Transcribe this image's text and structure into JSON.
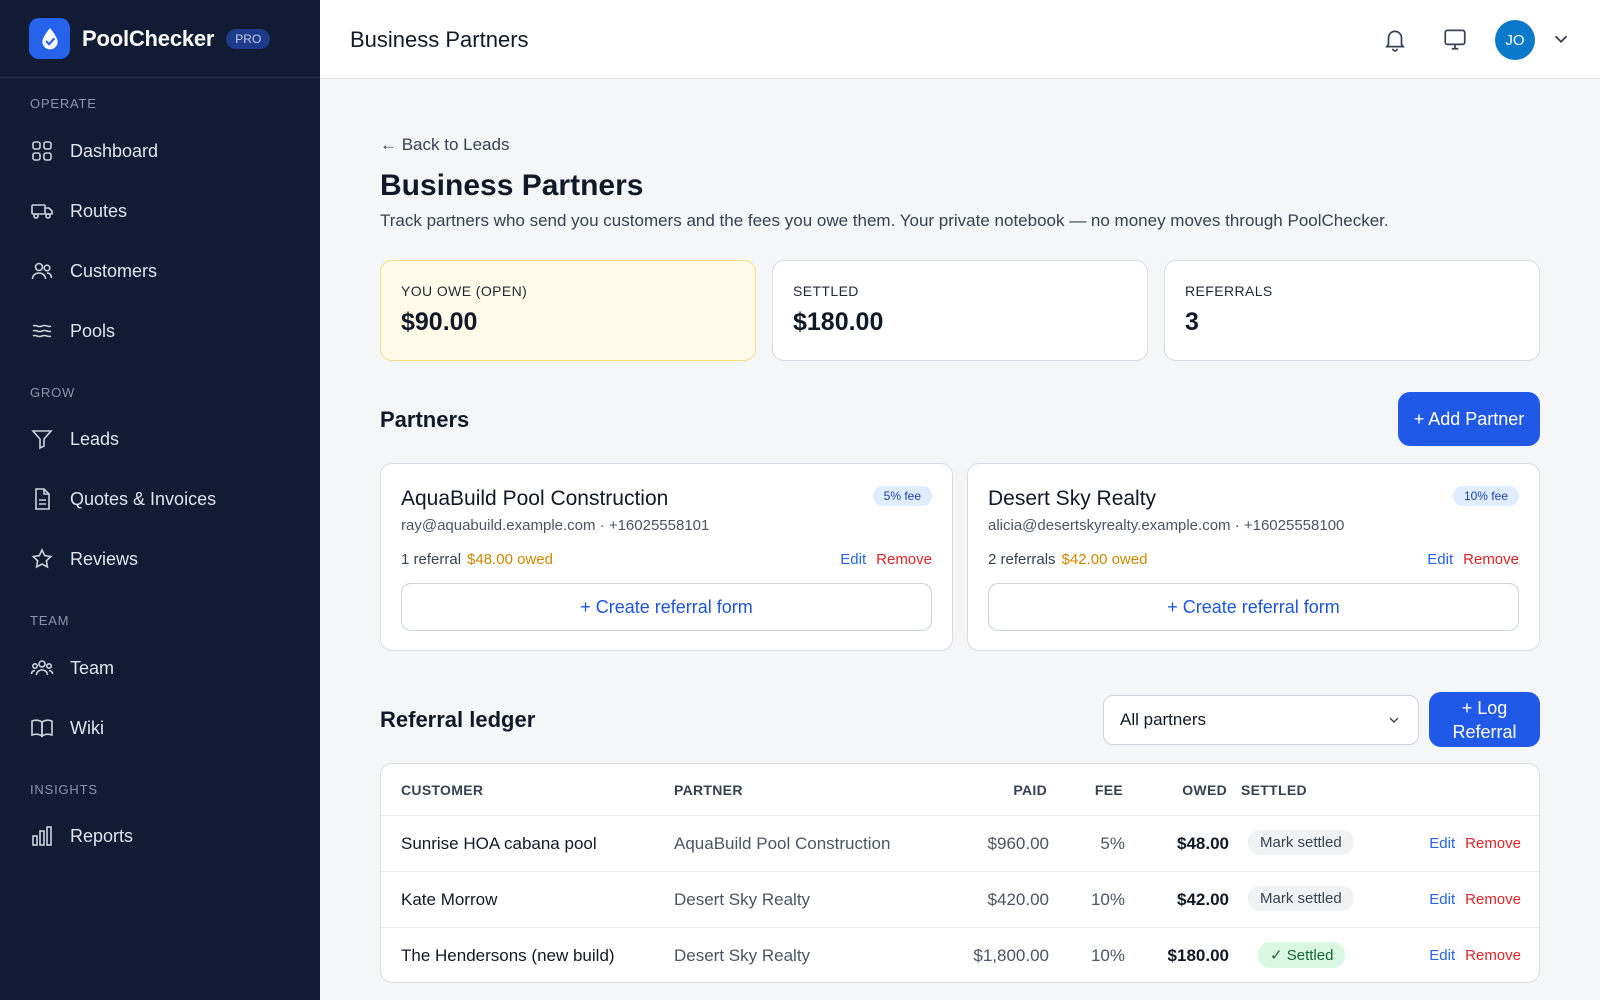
{
  "brand": {
    "name": "PoolChecker",
    "badge": "PRO"
  },
  "sidebar": {
    "sections": [
      {
        "title": "OPERATE",
        "items": [
          {
            "label": "Dashboard",
            "icon": "grid-icon"
          },
          {
            "label": "Routes",
            "icon": "truck-icon"
          },
          {
            "label": "Customers",
            "icon": "users-icon"
          },
          {
            "label": "Pools",
            "icon": "waves-icon"
          }
        ]
      },
      {
        "title": "GROW",
        "items": [
          {
            "label": "Leads",
            "icon": "funnel-icon"
          },
          {
            "label": "Quotes & Invoices",
            "icon": "document-icon"
          },
          {
            "label": "Reviews",
            "icon": "star-icon"
          }
        ]
      },
      {
        "title": "TEAM",
        "items": [
          {
            "label": "Team",
            "icon": "team-icon"
          },
          {
            "label": "Wiki",
            "icon": "book-icon"
          }
        ]
      },
      {
        "title": "INSIGHTS",
        "items": [
          {
            "label": "Reports",
            "icon": "bar-chart-icon"
          }
        ]
      }
    ]
  },
  "topbar": {
    "title": "Business Partners",
    "avatar_initials": "JO"
  },
  "page": {
    "back_link": "← Back to Leads",
    "title": "Business Partners",
    "description": "Track partners who send you customers and the fees you owe them. Your private notebook — no money moves through PoolChecker."
  },
  "stats": {
    "owe": {
      "label": "YOU OWE (OPEN)",
      "value": "$90.00"
    },
    "settled": {
      "label": "SETTLED",
      "value": "$180.00"
    },
    "referrals": {
      "label": "REFERRALS",
      "value": "3"
    }
  },
  "partners_section": {
    "title": "Partners",
    "add_button": "+ Add Partner"
  },
  "partners": [
    {
      "name": "AquaBuild Pool Construction",
      "contact": "ray@aquabuild.example.com · +16025558101",
      "fee": "5% fee",
      "referrals": "1 referral",
      "owed": "$48.00 owed",
      "edit": "Edit",
      "remove": "Remove",
      "create": "+ Create referral form"
    },
    {
      "name": "Desert Sky Realty",
      "contact": "alicia@desertskyrealty.example.com · +16025558100",
      "fee": "10% fee",
      "referrals": "2 referrals",
      "owed": "$42.00 owed",
      "edit": "Edit",
      "remove": "Remove",
      "create": "+ Create referral form"
    }
  ],
  "ledger": {
    "title": "Referral ledger",
    "filter_value": "All partners",
    "log_button": "+ Log Referral",
    "columns": {
      "customer": "CUSTOMER",
      "partner": "PARTNER",
      "paid": "PAID",
      "fee": "FEE",
      "owed": "OWED",
      "settled": "SETTLED"
    },
    "rows": [
      {
        "customer": "Sunrise HOA cabana pool",
        "partner": "AquaBuild Pool Construction",
        "paid": "$960.00",
        "fee": "5%",
        "owed": "$48.00",
        "status": "Mark settled",
        "edit": "Edit",
        "remove": "Remove"
      },
      {
        "customer": "Kate Morrow",
        "partner": "Desert Sky Realty",
        "paid": "$420.00",
        "fee": "10%",
        "owed": "$42.00",
        "status": "Mark settled",
        "edit": "Edit",
        "remove": "Remove"
      },
      {
        "customer": "The Hendersons (new build)",
        "partner": "Desert Sky Realty",
        "paid": "$1,800.00",
        "fee": "10%",
        "owed": "$180.00",
        "status": "✓ Settled",
        "edit": "Edit",
        "remove": "Remove"
      }
    ]
  }
}
